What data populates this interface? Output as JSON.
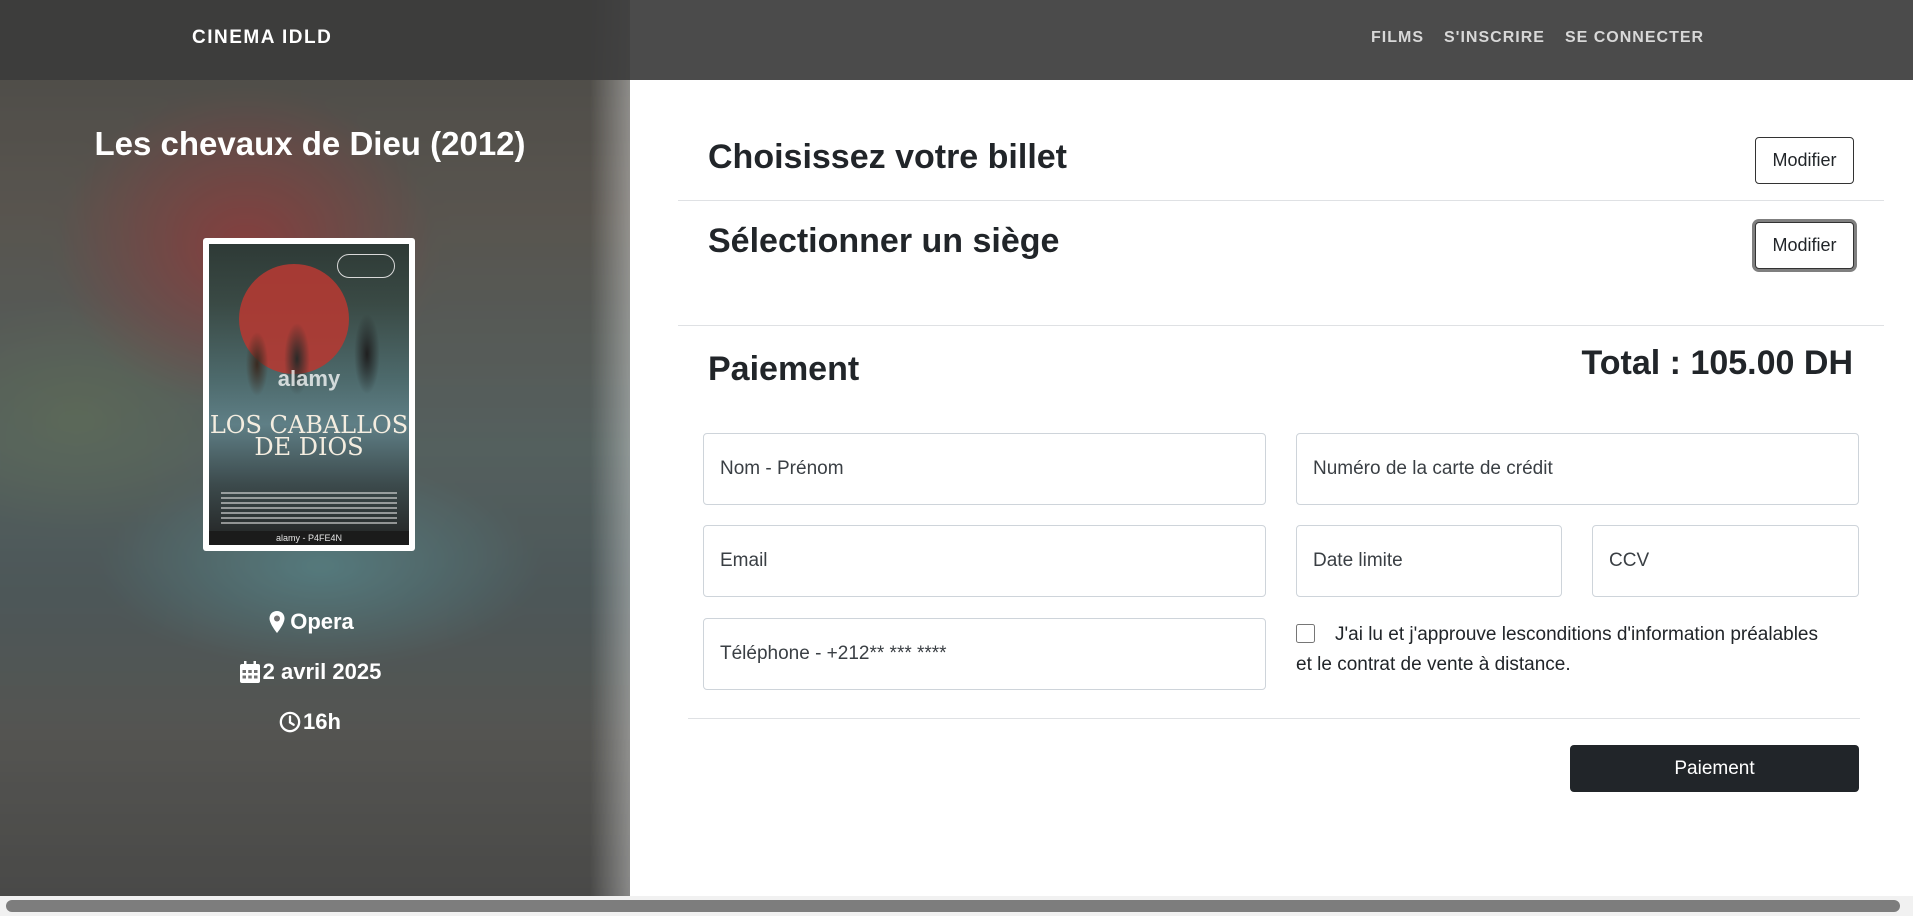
{
  "navbar": {
    "brand": "CINEMA IDLD",
    "links": [
      "FILMS",
      "S'INSCRIRE",
      "SE CONNECTER"
    ]
  },
  "movie": {
    "title": "Les chevaux de Dieu (2012)",
    "poster": {
      "title_line1": "LOS CABALLOS",
      "title_line2": "DE DIOS",
      "watermark": "alamy",
      "caption": "alamy - P4FE4N"
    },
    "location": "Opera",
    "date": "2 avril 2025",
    "time": "16h",
    "icons": [
      "location-pin-icon",
      "calendar-icon",
      "clock-icon"
    ]
  },
  "steps": {
    "ticket_title": "Choisissez votre billet",
    "seat_title": "Sélectionner un siège",
    "modify_label": "Modifier"
  },
  "payment": {
    "title": "Paiement",
    "total": "Total : 105.00 DH",
    "placeholders": {
      "name": "Nom - Prénom",
      "card": "Numéro de la carte de crédit",
      "email": "Email",
      "expiry": "Date limite",
      "ccv": "CCV",
      "phone": "Téléphone - +212** *** ****"
    },
    "terms_line1": "J'ai lu et j'approuve lesconditions d'information préalables",
    "terms_line2": "et le contrat de vente à distance.",
    "terms_checked": false,
    "submit_label": "Paiement"
  },
  "colors": {
    "navbar": "#3c3c3c",
    "primary_button": "#212529",
    "text": "#212529"
  }
}
